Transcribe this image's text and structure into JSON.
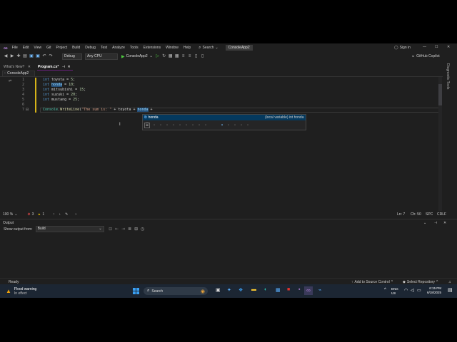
{
  "menu": [
    "File",
    "Edit",
    "View",
    "Git",
    "Project",
    "Build",
    "Debug",
    "Test",
    "Analyze",
    "Tools",
    "Extensions",
    "Window",
    "Help"
  ],
  "search_label": "Search",
  "solution_badge": "ConsoleApp2",
  "sign_in": "Sign in",
  "toolbar": {
    "config": "Debug",
    "platform": "Any CPU",
    "run_target": "ConsoleApp2",
    "copilot": "GitHub Copilot"
  },
  "tabs": {
    "whats_new": "What's New?",
    "file": "Program.cs*"
  },
  "side_panel": "Diagnostic Tools",
  "nav": {
    "project": "ConsoleApp2"
  },
  "code": {
    "line_numbers": [
      "1",
      "2",
      "3",
      "4",
      "5",
      "6",
      "7"
    ],
    "lines": [
      [
        {
          "t": "int",
          "c": "kw"
        },
        {
          "t": " toyota = ",
          "c": "plain"
        },
        {
          "t": "5",
          "c": "num"
        },
        {
          "t": ";",
          "c": "plain"
        }
      ],
      [
        {
          "t": "int",
          "c": "kw"
        },
        {
          "t": " ",
          "c": "plain"
        },
        {
          "t": "honda",
          "c": "var"
        },
        {
          "t": " = ",
          "c": "plain"
        },
        {
          "t": "10",
          "c": "num"
        },
        {
          "t": ";",
          "c": "plain"
        }
      ],
      [
        {
          "t": "int",
          "c": "kw"
        },
        {
          "t": " mitsubishi = ",
          "c": "plain"
        },
        {
          "t": "15",
          "c": "num"
        },
        {
          "t": ";",
          "c": "plain"
        }
      ],
      [
        {
          "t": "int",
          "c": "kw"
        },
        {
          "t": " suzuki = ",
          "c": "plain"
        },
        {
          "t": "20",
          "c": "num"
        },
        {
          "t": ";",
          "c": "plain"
        }
      ],
      [
        {
          "t": "int",
          "c": "kw"
        },
        {
          "t": " mustang = ",
          "c": "plain"
        },
        {
          "t": "25",
          "c": "num"
        },
        {
          "t": ";",
          "c": "plain"
        }
      ],
      [],
      [
        {
          "t": "Console",
          "c": "cls"
        },
        {
          "t": ".",
          "c": "plain"
        },
        {
          "t": "WriteLine",
          "c": "fn"
        },
        {
          "t": "(",
          "c": "plain"
        },
        {
          "t": "\"The sum is: \"",
          "c": "str"
        },
        {
          "t": " + toyota + ",
          "c": "plain"
        },
        {
          "t": "honda",
          "c": "var"
        },
        {
          "t": " +",
          "c": "plain"
        }
      ]
    ]
  },
  "completion": {
    "item": "honda",
    "detail": "(local variable) int honda"
  },
  "editor_status": {
    "zoom": "100 %",
    "errors": "3",
    "warnings": "1",
    "line": "Ln: 7",
    "col": "Ch: 50",
    "spc": "SPC",
    "crlf": "CRLF"
  },
  "output": {
    "title": "Output",
    "show_from": "Show output from:",
    "source": "Build"
  },
  "status": {
    "ready": "Ready",
    "source_control": "Add to Source Control",
    "repo": "Select Repository"
  },
  "taskbar": {
    "weather_title": "Flood warning",
    "weather_sub": "In effect",
    "search": "Search",
    "lang1": "ENG",
    "lang2": "US",
    "time": "6:15 PM",
    "date": "6/18/2025"
  },
  "colors": {
    "accent": "#68217a",
    "editor_bg": "#1f1f1f",
    "taskbar": "#1c2633"
  }
}
